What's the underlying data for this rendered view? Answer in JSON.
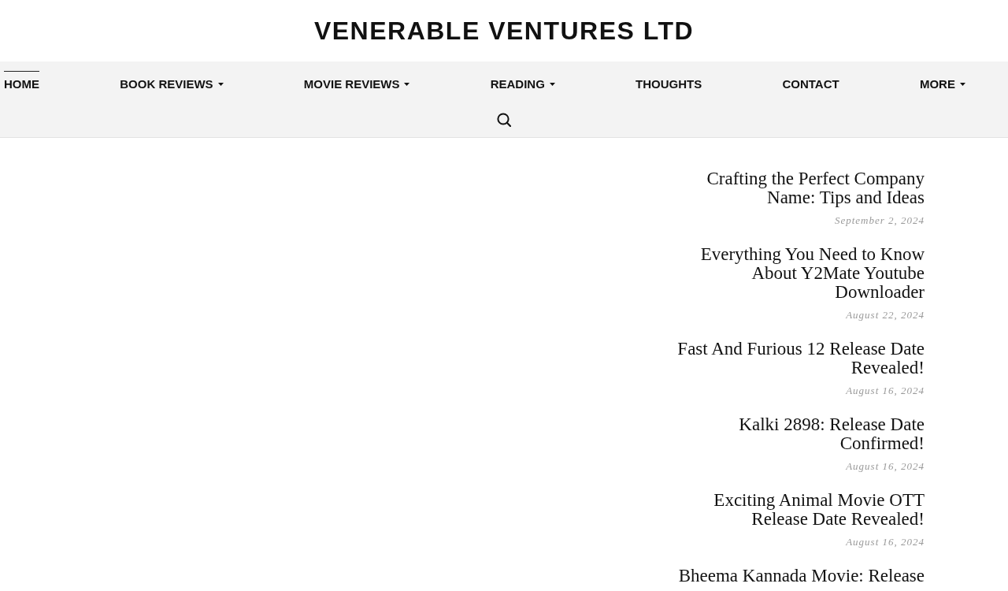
{
  "site_title": "VENERABLE VENTURES LTD",
  "nav": {
    "items": [
      {
        "label": "HOME",
        "selected": true,
        "has_dropdown": false
      },
      {
        "label": "BOOK REVIEWS",
        "selected": false,
        "has_dropdown": true
      },
      {
        "label": "MOVIE REVIEWS",
        "selected": false,
        "has_dropdown": true
      },
      {
        "label": "READING",
        "selected": false,
        "has_dropdown": true
      },
      {
        "label": "THOUGHTS",
        "selected": false,
        "has_dropdown": false
      },
      {
        "label": "CONTACT",
        "selected": false,
        "has_dropdown": false
      },
      {
        "label": "MORE",
        "selected": false,
        "has_dropdown": true
      }
    ]
  },
  "posts": [
    {
      "title": "Crafting the Perfect Company Name: Tips and Ideas",
      "date": "September 2, 2024"
    },
    {
      "title": "Everything You Need to Know About Y2Mate Youtube Downloader",
      "date": "August 22, 2024"
    },
    {
      "title": "Fast And Furious 12 Release Date Revealed!",
      "date": "August 16, 2024"
    },
    {
      "title": "Kalki 2898: Release Date Confirmed!",
      "date": "August 16, 2024"
    },
    {
      "title": "Exciting Animal Movie OTT Release Date Revealed!",
      "date": "August 16, 2024"
    },
    {
      "title": "Bheema Kannada Movie: Release"
    }
  ]
}
